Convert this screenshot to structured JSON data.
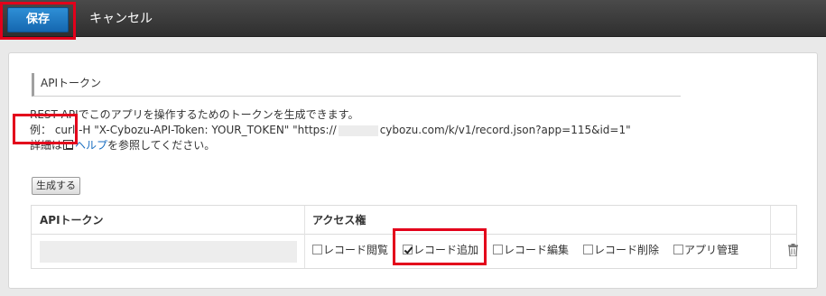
{
  "toolbar": {
    "save_label": "保存",
    "cancel_label": "キャンセル"
  },
  "section": {
    "title": "APIトークン"
  },
  "description": {
    "line1": "REST APIでこのアプリを操作するためのトークンを生成できます。",
    "line2_prefix": "例：  curl -H \"X-Cybozu-API-Token: YOUR_TOKEN\" \"https://",
    "line2_suffix": "cybozu.com/k/v1/record.json?app=115&id=1\"",
    "line3_prefix": "詳細は",
    "help_link": "ヘルプ",
    "line3_suffix": "を参照してください。"
  },
  "generate_button": "生成する",
  "table": {
    "headers": {
      "token": "APIトークン",
      "access": "アクセス権"
    },
    "permissions": [
      {
        "label": "レコード閲覧",
        "checked": false
      },
      {
        "label": "レコード追加",
        "checked": true
      },
      {
        "label": "レコード編集",
        "checked": false
      },
      {
        "label": "レコード削除",
        "checked": false
      },
      {
        "label": "アプリ管理",
        "checked": false
      }
    ],
    "delete_icon": "trash-icon"
  },
  "colors": {
    "primary_button": "#1f7ac6",
    "highlight": "#e3001b",
    "link": "#1a6ec0",
    "topbar": "#3a3a3a"
  }
}
